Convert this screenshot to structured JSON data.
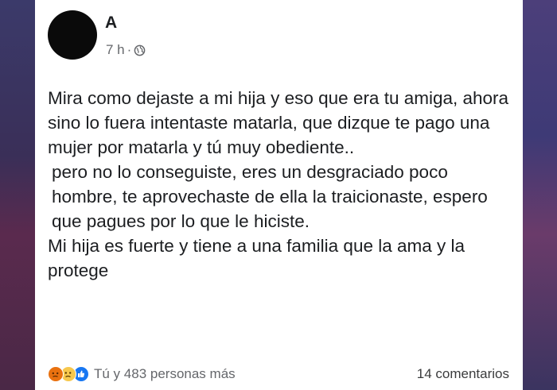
{
  "post": {
    "author": "A",
    "time": "7 h",
    "separator": "·",
    "privacy_icon": "globe-icon",
    "paragraphs": [
      "Mira como dejaste a mi hija y eso que era tu amiga, ahora sino lo fuera intentaste matarla, que dizque te pago una mujer por matarla y tú muy obediente..",
      "pero no lo conseguiste, eres un desgraciado poco hombre, te aprovechaste de ella la traicionaste, espero que pagues por lo que le hiciste.",
      "Mi hija es fuerte y tiene a una familia que la ama y la protege"
    ]
  },
  "footer": {
    "reactions": [
      "angry",
      "sad",
      "like"
    ],
    "reactions_text": "Tú y 483 personas más",
    "comments_text": "14 comentarios"
  },
  "colors": {
    "card_bg": "#ffffff",
    "text": "#1c1e21",
    "secondary_text": "#65676b",
    "like_blue": "#1877f2"
  }
}
